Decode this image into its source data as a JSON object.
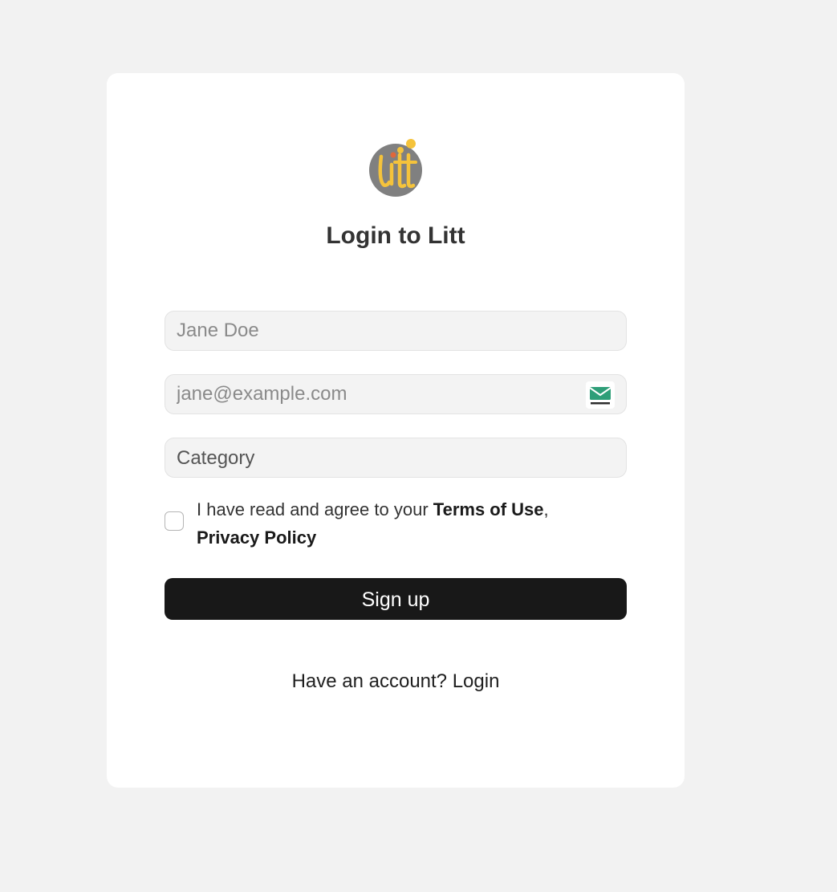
{
  "header": {
    "title": "Login to Litt",
    "logo_icon": "litt-logo"
  },
  "form": {
    "name_placeholder": "Jane Doe",
    "email_placeholder": "jane@example.com",
    "email_extension_icon": "tempmail-icon",
    "category_value": "Category",
    "agree_prefix": "I have read and agree to your",
    "terms_label": "Terms of Use",
    "separator": ",",
    "privacy_label": "Privacy Policy",
    "agree_checked": false,
    "submit_label": "Sign up"
  },
  "footer": {
    "prompt": "Have an account?",
    "login_label": "Login"
  },
  "colors": {
    "background": "#f2f2f2",
    "card": "#ffffff",
    "button": "#181818",
    "logo_circle": "#808080",
    "logo_letters": "#f5c33b",
    "logo_dot_red": "#e0673a",
    "tempmail_green": "#2e9e78"
  }
}
